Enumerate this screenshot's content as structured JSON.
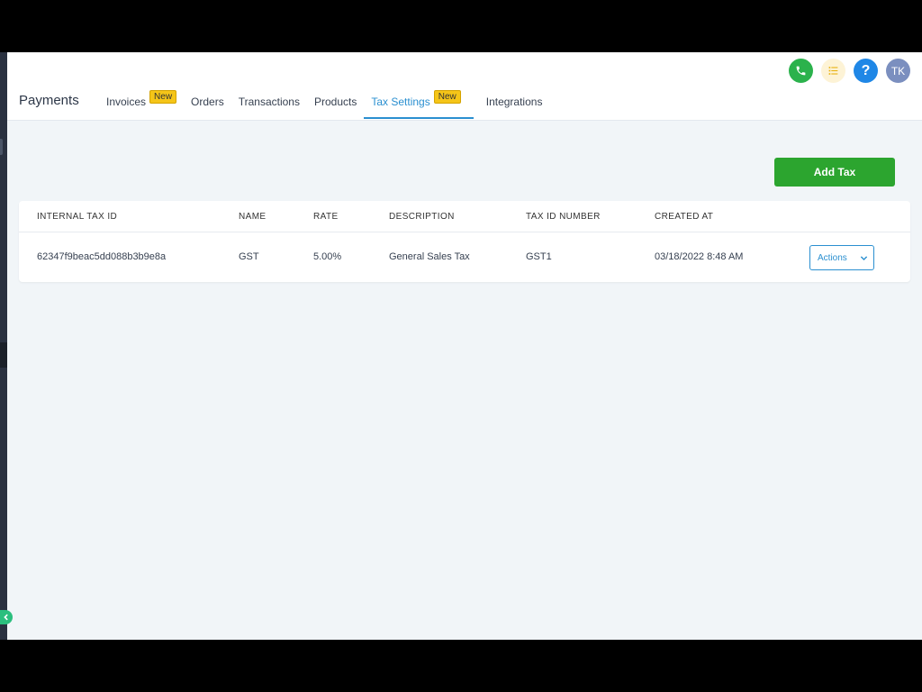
{
  "header": {
    "brand": "Payments",
    "avatar_initials": "TK",
    "help_glyph": "?"
  },
  "tabs": [
    {
      "label": "Invoices",
      "badge": "New",
      "active": false
    },
    {
      "label": "Orders",
      "badge": "",
      "active": false
    },
    {
      "label": "Transactions",
      "badge": "",
      "active": false
    },
    {
      "label": "Products",
      "badge": "",
      "active": false
    },
    {
      "label": "Tax Settings",
      "badge": "New",
      "active": true
    },
    {
      "label": "Integrations",
      "badge": "",
      "active": false
    }
  ],
  "toolbar": {
    "add_tax_label": "Add Tax"
  },
  "table": {
    "columns": [
      "INTERNAL TAX ID",
      "NAME",
      "RATE",
      "DESCRIPTION",
      "TAX ID NUMBER",
      "CREATED AT"
    ],
    "rows": [
      {
        "internal_tax_id": "62347f9beac5dd088b3b9e8a",
        "name": "GST",
        "rate": "5.00%",
        "description": "General Sales Tax",
        "tax_id_number": "GST1",
        "created_at": "03/18/2022 8:48 AM",
        "actions_label": "Actions"
      }
    ]
  },
  "colors": {
    "accent": "#2a8fd0",
    "primary_button": "#2ca52f",
    "badge": "#f5c518"
  },
  "icons": [
    "phone-icon",
    "list-icon",
    "help-icon",
    "chevron-down-icon",
    "chevron-left-icon"
  ]
}
